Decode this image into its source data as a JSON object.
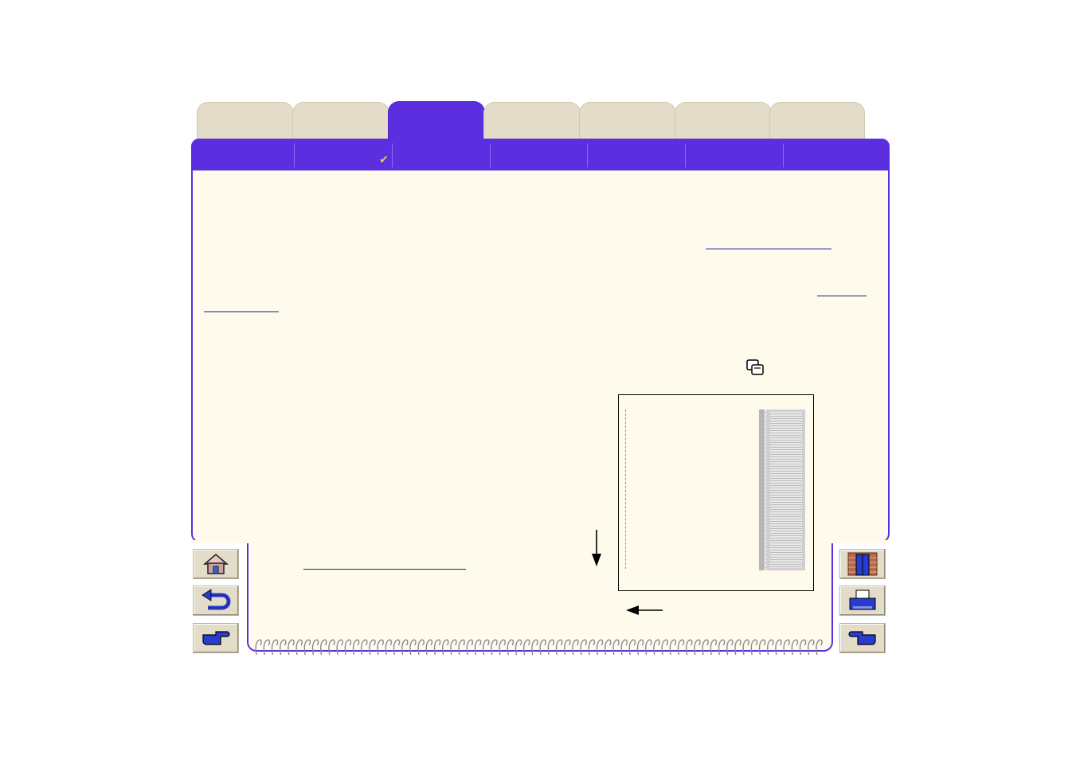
{
  "app": {
    "tabs": [
      {
        "name": "tab-1",
        "label": ""
      },
      {
        "name": "tab-2",
        "label": ""
      },
      {
        "name": "tab-3",
        "label": "",
        "active": true
      },
      {
        "name": "tab-4",
        "label": ""
      },
      {
        "name": "tab-5",
        "label": ""
      },
      {
        "name": "tab-6",
        "label": ""
      },
      {
        "name": "tab-7",
        "label": ""
      }
    ],
    "subtabs": [
      "",
      "",
      "",
      "",
      "",
      "",
      ""
    ],
    "colors": {
      "accent": "#5b2ee0",
      "panel_bg": "#fffbec",
      "tab_bg": "#e2dcc8",
      "link": "#1a1a9c"
    }
  },
  "nav": {
    "left": [
      "home-icon",
      "back-icon",
      "next-page-icon"
    ],
    "right": [
      "exit-door-icon",
      "printer-icon",
      "prev-page-icon"
    ]
  },
  "icons": {
    "inline": "overlapping-windows-icon",
    "check": "checkmark-icon"
  }
}
